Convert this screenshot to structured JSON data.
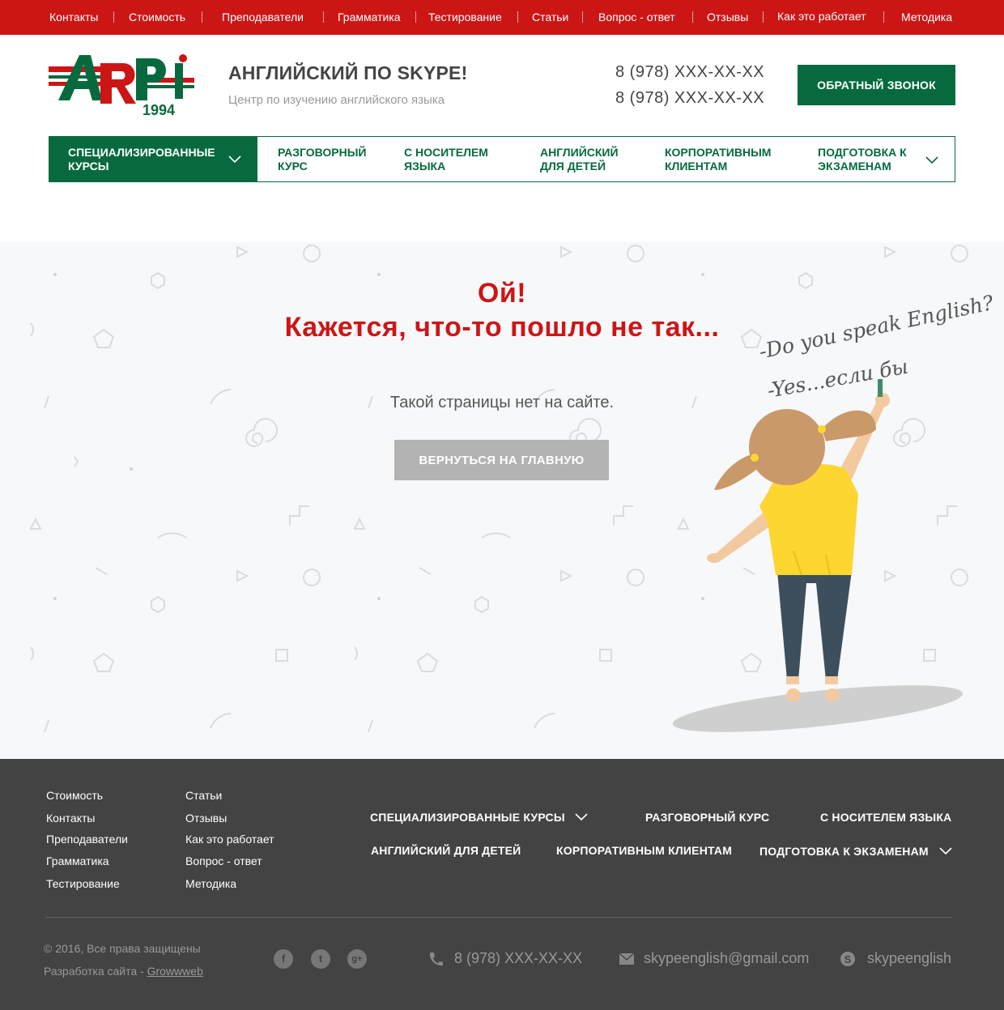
{
  "topnav": [
    "Контакты",
    "Стоимость",
    "Преподаватели",
    "Грамматика",
    "Тестирование",
    "Статьи",
    "Вопрос - ответ",
    "Отзывы",
    "Как это работает",
    "Методика"
  ],
  "logo": {
    "text_main": "ARPi",
    "year": "1994"
  },
  "header": {
    "title": "АНГЛИЙСКИЙ ПО SKYPE!",
    "subtitle": "Центр по изучению английского языка",
    "phone1": "8 (978) XXX-XX-XX",
    "phone2": "8 (978) XXX-XX-XX",
    "callback": "ОБРАТНЫЙ ЗВОНОК"
  },
  "mainnav": {
    "items": [
      {
        "l1": "СПЕЦИАЛИЗИРОВАННЫЕ",
        "l2": "КУРСЫ"
      },
      {
        "l1": "РАЗГОВОРНЫЙ",
        "l2": "КУРС"
      },
      {
        "l1": "С НОСИТЕЛЕМ",
        "l2": "ЯЗЫКА"
      },
      {
        "l1": "АНГЛИЙСКИЙ",
        "l2": "ДЛЯ ДЕТЕЙ"
      },
      {
        "l1": "КОРПОРАТИВНЫМ",
        "l2": "КЛИЕНТАМ"
      },
      {
        "l1": "ПОДГОТОВКА К",
        "l2": "ЭКЗАМЕНАМ"
      }
    ]
  },
  "error": {
    "line1": "Ой!",
    "line2": "Кажется, что-то пошло не так...",
    "message": "Такой страницы нет на сайте.",
    "button": "ВЕРНУТЬСЯ НА ГЛАВНУЮ",
    "note1": "-Do you speak English?",
    "note2": "-Yes...если бы"
  },
  "footer": {
    "col1": [
      "Стоимость",
      "Контакты",
      "Преподаватели",
      "Грамматика",
      "Тестирование"
    ],
    "col2": [
      "Статьи",
      "Отзывы",
      "Как это работает",
      "Вопрос - ответ",
      "Методика"
    ],
    "courses": [
      "СПЕЦИАЛИЗИРОВАННЫЕ КУРСЫ",
      "РАЗГОВОРНЫЙ КУРС",
      "С НОСИТЕЛЕМ ЯЗЫКА",
      "АНГЛИЙСКИЙ ДЛЯ ДЕТЕЙ",
      "КОРПОРАТИВНЫМ КЛИЕНТАМ",
      "ПОДГОТОВКА К ЭКЗАМЕНАМ"
    ],
    "copyright": "© 2016, Все права защищены",
    "dev_prefix": "Разработка сайта - ",
    "dev_link": "Growwweb",
    "social": [
      "f",
      "t",
      "g+"
    ],
    "phone": "8 (978) XXX-XX-XX",
    "email": "skypeenglish@gmail.com",
    "skype": "skypeenglish"
  },
  "colors": {
    "brand_red": "#cc1616",
    "brand_green": "#066a3e",
    "footer_bg": "#434343",
    "button_grey": "#b3b3b3"
  }
}
